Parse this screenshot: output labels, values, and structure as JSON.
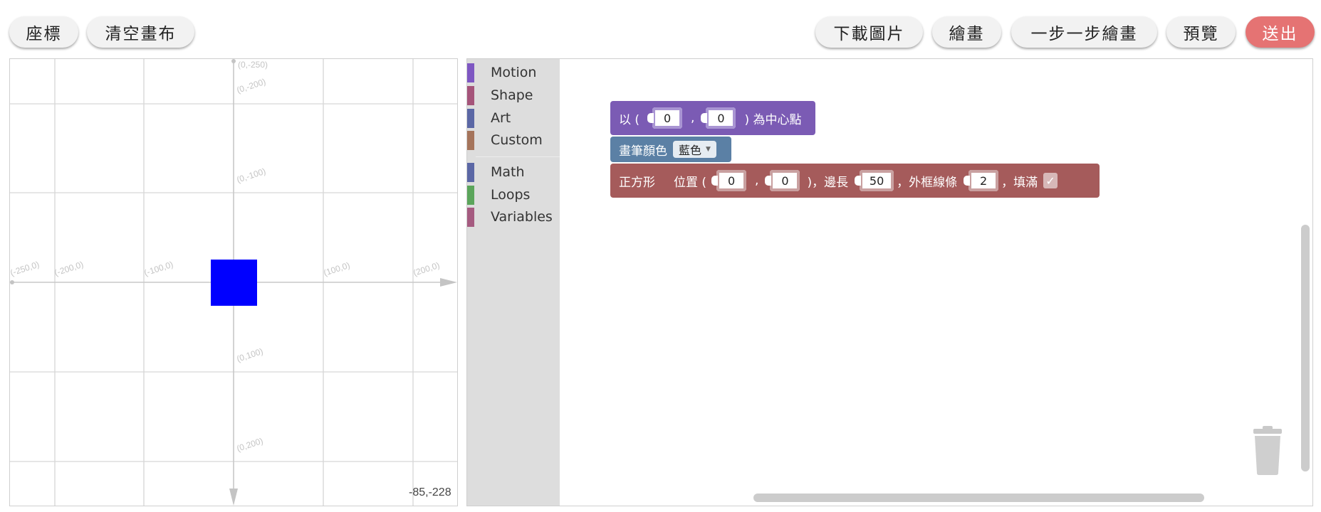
{
  "toolbar": {
    "coords_label": "座標",
    "clear_label": "清空畫布",
    "download_label": "下載圖片",
    "draw_label": "繪畫",
    "step_draw_label": "一步一步繪畫",
    "preview_label": "預覽",
    "send_label": "送出"
  },
  "canvas": {
    "labels": {
      "top_point": "(0,-250)",
      "y_minus_200": "(0,-200)",
      "y_minus_100": "(0,-100)",
      "y_100": "(0,100)",
      "y_200": "(0,200)",
      "x_minus_250": "(-250,0)",
      "x_minus_200": "(-200,0)",
      "x_minus_100": "(-100,0)",
      "x_100": "(100,0)",
      "x_200": "(200,0)"
    },
    "cursor_readout": "-85,-228",
    "square_color": "#0000ff",
    "square_center": [
      0,
      0
    ],
    "square_side": 50
  },
  "toolbox": {
    "categories": [
      {
        "label": "Motion",
        "color": "#7e57c2"
      },
      {
        "label": "Shape",
        "color": "#a5547a"
      },
      {
        "label": "Art",
        "color": "#5b67a5"
      },
      {
        "label": "Custom",
        "color": "#a5745b"
      },
      {
        "label": "Math",
        "color": "#5b67a5"
      },
      {
        "label": "Loops",
        "color": "#5ba55b"
      },
      {
        "label": "Variables",
        "color": "#a55b80"
      }
    ]
  },
  "blocks": {
    "center": {
      "prefix": "以 (",
      "x": "0",
      "comma": ",",
      "y": "0",
      "suffix": ") 為中心點",
      "color": "#7b5bb4"
    },
    "pen_color": {
      "label": "畫筆顏色",
      "value": "藍色",
      "color": "#5b80a5"
    },
    "square": {
      "name": "正方形",
      "position_label": "位置 (",
      "x": "0",
      "comma": ",",
      "y": "0",
      "side_label": ")，邊長",
      "side": "50",
      "border_label": "，外框線條",
      "border": "2",
      "fill_label": "，填滿",
      "filled": "✓",
      "color": "#a55b5b"
    }
  }
}
